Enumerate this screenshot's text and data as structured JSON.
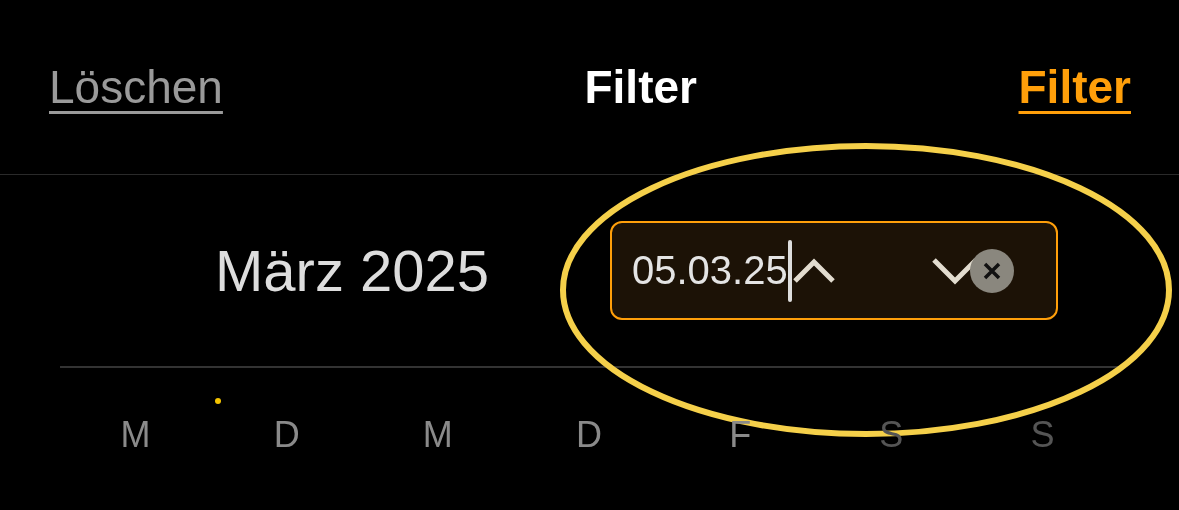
{
  "header": {
    "clear_button": "Löschen",
    "title": "Filter",
    "apply_button": "Filter"
  },
  "calendar": {
    "month": "März 2025",
    "date_field": {
      "value": "05.03.25",
      "focused": true
    },
    "weekdays": [
      {
        "label": "M",
        "weekend": false,
        "marked": false
      },
      {
        "label": "D",
        "weekend": false,
        "marked": true
      },
      {
        "label": "M",
        "weekend": false,
        "marked": false
      },
      {
        "label": "D",
        "weekend": false,
        "marked": false
      },
      {
        "label": "F",
        "weekend": false,
        "marked": false
      },
      {
        "label": "S",
        "weekend": true,
        "marked": false
      },
      {
        "label": "S",
        "weekend": true,
        "marked": false
      }
    ]
  },
  "annotation": {
    "kind": "ellipse",
    "color": "#f5d04a"
  }
}
